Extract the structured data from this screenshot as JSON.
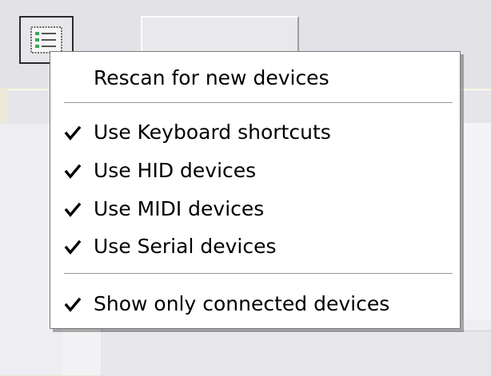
{
  "toolbar": {
    "device_list_icon": "device-list-icon"
  },
  "context_menu": {
    "items": [
      {
        "label": "Rescan for new devices",
        "checked": false
      },
      {
        "label": "Use Keyboard shortcuts",
        "checked": true
      },
      {
        "label": "Use HID devices",
        "checked": true
      },
      {
        "label": "Use MIDI devices",
        "checked": true
      },
      {
        "label": "Use Serial devices",
        "checked": true
      },
      {
        "label": "Show only connected devices",
        "checked": true
      }
    ]
  },
  "colors": {
    "menu_background": "#ffffff",
    "menu_text": "#000000",
    "window_background": "#e3e2e7",
    "icon_accent": "#3aa655"
  }
}
